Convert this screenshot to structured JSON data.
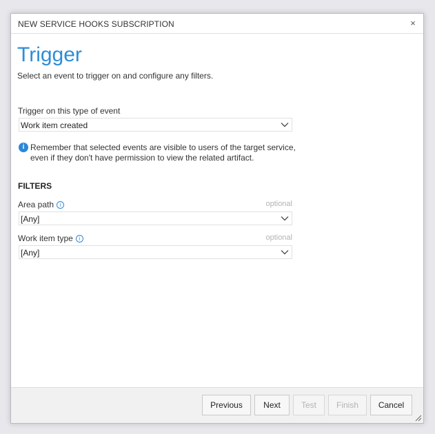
{
  "dialog": {
    "title": "NEW SERVICE HOOKS SUBSCRIPTION",
    "close_glyph": "×"
  },
  "page": {
    "heading": "Trigger",
    "subtitle": "Select an event to trigger on and configure any filters."
  },
  "trigger": {
    "label": "Trigger on this type of event",
    "value": "Work item created"
  },
  "notice": {
    "text": "Remember that selected events are visible to users of the target service, even if they don't have permission to view the related artifact."
  },
  "filters": {
    "heading": "FILTERS",
    "area_path": {
      "label": "Area path",
      "optional": "optional",
      "value": "[Any]"
    },
    "work_item_type": {
      "label": "Work item type",
      "optional": "optional",
      "value": "[Any]"
    }
  },
  "buttons": {
    "previous": "Previous",
    "next": "Next",
    "test": "Test",
    "finish": "Finish",
    "cancel": "Cancel"
  },
  "colors": {
    "accent": "#2e8dd6",
    "info": "#2b88d8"
  }
}
